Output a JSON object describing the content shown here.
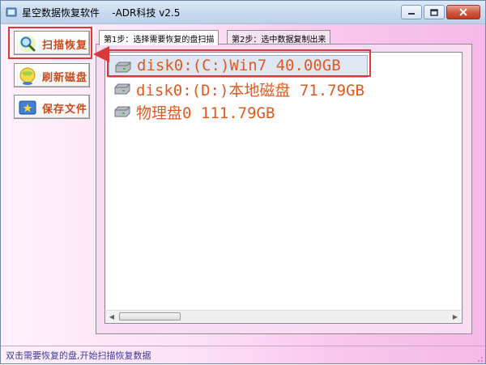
{
  "window": {
    "title": "星空数据恢复软件    -ADR科技 v2.5",
    "title_color": "#000000"
  },
  "sidebar": {
    "buttons": [
      {
        "label": "扫描恢复",
        "icon": "magnifier-icon"
      },
      {
        "label": "刷新磁盘",
        "icon": "refresh-globe-icon"
      },
      {
        "label": "保存文件",
        "icon": "save-icon"
      }
    ],
    "label_color": "#cc4a1c"
  },
  "tabs": [
    {
      "label": "第1步：选择需要恢复的盘扫描",
      "active": true
    },
    {
      "label": "第2步：选中数据复制出来",
      "active": false
    }
  ],
  "disks": [
    {
      "label": "disk0:(C:)Win7 40.00GB",
      "selected": true,
      "icon": "hard-drive-icon"
    },
    {
      "label": "disk0:(D:)本地磁盘 71.79GB",
      "selected": false,
      "icon": "hard-drive-icon"
    },
    {
      "label": "物理盘0 111.79GB",
      "selected": false,
      "icon": "hard-drive-icon"
    }
  ],
  "status": {
    "text": "双击需要恢复的盘,开始扫描恢复数据"
  },
  "colors": {
    "highlight": "#d83a3a",
    "disk_text": "#e05a20"
  }
}
